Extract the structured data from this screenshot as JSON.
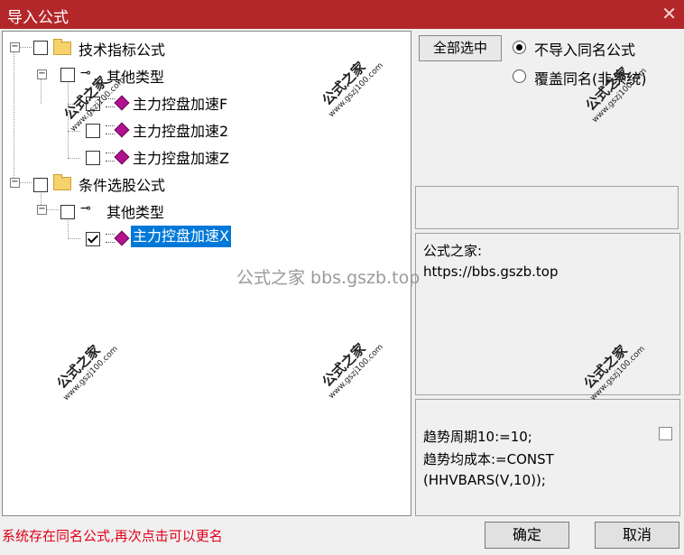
{
  "window": {
    "title": "导入公式",
    "close_icon": "✕"
  },
  "tree": {
    "nodes": [
      {
        "label": "技术指标公式",
        "level": 0,
        "checked": false,
        "expanded": true,
        "icon": "folder-icon"
      },
      {
        "label": "其他类型",
        "level": 1,
        "checked": false,
        "expanded": true,
        "icon": "key-icon"
      },
      {
        "label": "主力控盘加速F",
        "level": 2,
        "checked": false,
        "icon": "formula-gem-icon"
      },
      {
        "label": "主力控盘加速2",
        "level": 2,
        "checked": false,
        "icon": "formula-gem-icon"
      },
      {
        "label": "主力控盘加速Z",
        "level": 2,
        "checked": false,
        "icon": "formula-gem-icon"
      },
      {
        "label": "条件选股公式",
        "level": 0,
        "checked": false,
        "expanded": true,
        "icon": "folder-icon"
      },
      {
        "label": "其他类型",
        "level": 1,
        "checked": false,
        "expanded": true,
        "icon": "key-icon"
      },
      {
        "label": "主力控盘加速X",
        "level": 2,
        "checked": true,
        "selected": true,
        "icon": "formula-gem-icon"
      }
    ]
  },
  "options": {
    "select_all_label": "全部选中",
    "radio_no_import_same": "不导入同名公式",
    "radio_overwrite_same": "覆盖同名(非系统)",
    "selected_radio": "no_import_same"
  },
  "info": {
    "line1": "公式之家:",
    "line2": "https://bbs.gszb.top"
  },
  "code": {
    "line1": "趋势周期10:=10;",
    "line2": "趋势均成本:=CONST",
    "line3": "(HHVBARS(V,10));"
  },
  "status_text": "系统存在同名公式,再次点击可以更名",
  "buttons": {
    "ok": "确定",
    "cancel": "取消"
  },
  "watermark": {
    "center": "公式之家 bbs.gszb.top",
    "stamp": "公式之家",
    "stamp_url": "www.gszj100.com"
  },
  "colors": {
    "titlebar": "#b3272a",
    "selection": "#0078d7",
    "status": "#e0001a"
  }
}
